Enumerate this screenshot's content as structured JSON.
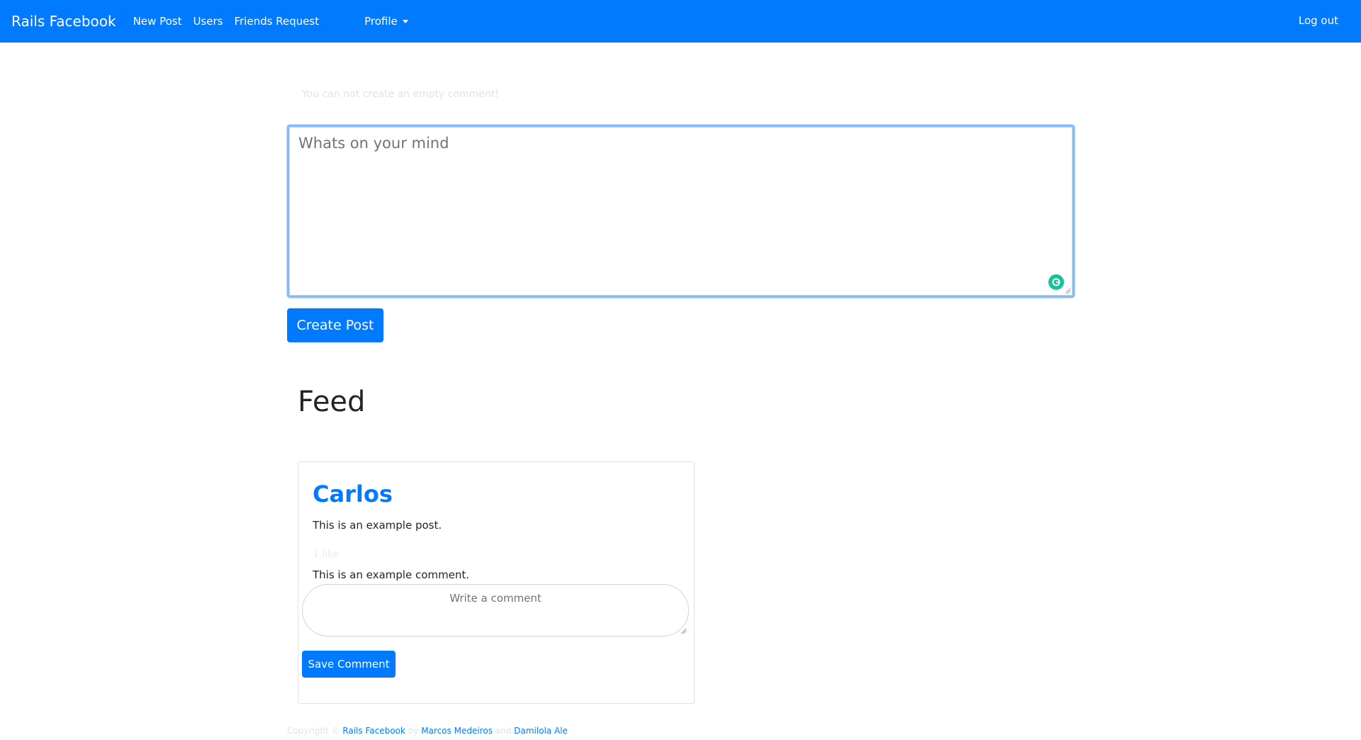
{
  "navbar": {
    "brand": "Rails Facebook",
    "links": [
      "New Post",
      "Users",
      "Friends Request"
    ],
    "profile": "Profile",
    "logout": "Log out",
    "color": "#007bff"
  },
  "flash": {
    "message": "You can not create an empty comment!"
  },
  "post_form": {
    "placeholder": "Whats on your mind",
    "submit_label": "Create Post"
  },
  "feed": {
    "title": "Feed",
    "posts": [
      {
        "author": "Carlos",
        "body": "This is an example post.",
        "likes": "1 like",
        "comments": [
          "This is an example comment."
        ],
        "comment_placeholder": "Write a comment",
        "save_label": "Save Comment"
      }
    ]
  },
  "footer": {
    "copyright": "Copyright ©",
    "site_link": "Rails Facebook",
    "by": "by",
    "author1": "Marcos Medeiros",
    "and": "and",
    "author2": "Damilola Ale"
  },
  "icons": {
    "grammarly": "grammarly-icon",
    "caret": "caret-down-icon"
  }
}
